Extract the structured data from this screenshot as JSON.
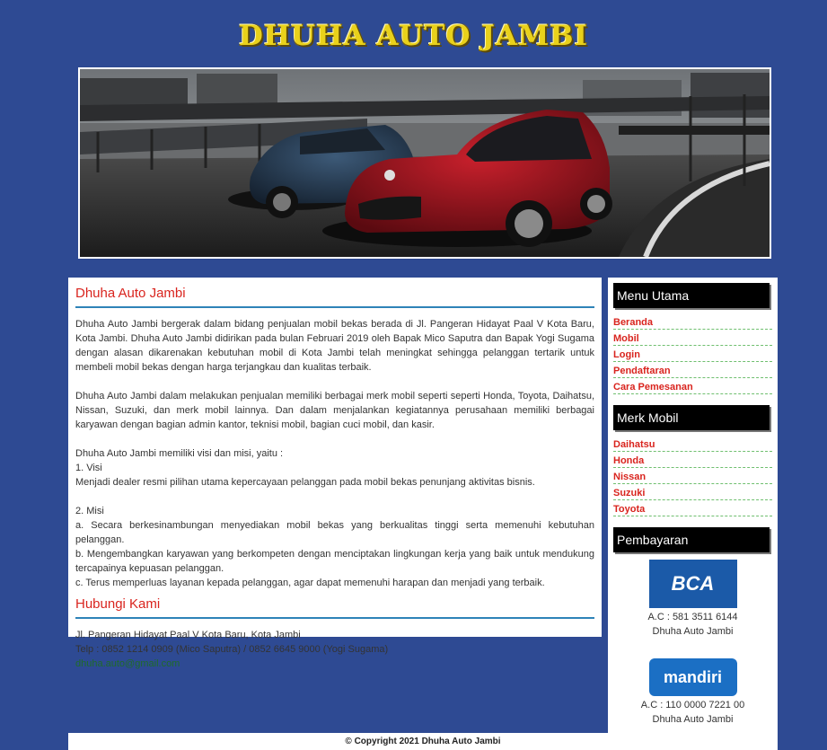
{
  "header": {
    "site_title": "DHUHA AUTO JAMBI"
  },
  "main": {
    "about_title": "Dhuha Auto Jambi",
    "paragraphs": [
      "Dhuha Auto Jambi bergerak dalam bidang penjualan mobil bekas berada di Jl. Pangeran Hidayat Paal V Kota Baru, Kota Jambi. Dhuha Auto Jambi didirikan pada bulan Februari 2019 oleh Bapak Mico Saputra dan Bapak Yogi Sugama dengan alasan dikarenakan kebutuhan mobil di Kota Jambi telah meningkat sehingga pelanggan tertarik untuk membeli mobil bekas dengan harga terjangkau dan kualitas terbaik.",
      "Dhuha Auto Jambi dalam melakukan penjualan memiliki berbagai merk mobil seperti seperti Honda, Toyota, Daihatsu, Nissan, Suzuki, dan merk mobil lainnya. Dan dalam menjalankan kegiatannya perusahaan memiliki berbagai karyawan dengan bagian admin kantor, teknisi mobil, bagian cuci mobil, dan kasir."
    ],
    "visi_misi_intro": "Dhuha Auto Jambi memiliki visi dan misi, yaitu :",
    "visi_label": "1. Visi",
    "visi_text": "Menjadi dealer resmi pilihan utama kepercayaan pelanggan pada mobil bekas penunjang aktivitas bisnis.",
    "misi_label": "2. Misi",
    "misi_items": [
      "a. Secara berkesinambungan menyediakan mobil bekas yang berkualitas tinggi serta memenuhi kebutuhan pelanggan.",
      "b. Mengembangkan karyawan yang berkompeten dengan menciptakan lingkungan kerja yang baik untuk mendukung tercapainya kepuasan pelanggan.",
      "c. Terus memperluas layanan kepada pelanggan, agar dapat memenuhi harapan dan menjadi yang terbaik."
    ],
    "contact_title": "Hubungi Kami",
    "contact_address": "Jl. Pangeran Hidayat Paal V Kota Baru, Kota Jambi",
    "contact_phone": "Telp : 0852 1214 0909 (Mico Saputra) / 0852 6645 9000 (Yogi Sugama)",
    "contact_email": "dhuha.auto@gmail.com"
  },
  "sidebar": {
    "menu_title": "Menu Utama",
    "menu_items": [
      "Beranda",
      "Mobil",
      "Login",
      "Pendaftaran",
      "Cara Pemesanan"
    ],
    "brand_title": "Merk Mobil",
    "brand_items": [
      "Daihatsu",
      "Honda",
      "Nissan",
      "Suzuki",
      "Toyota"
    ],
    "payment_title": "Pembayaran",
    "bca_logo_text": "BCA",
    "bca_account": "A.C : 581 3511 6144",
    "bca_name": "Dhuha Auto Jambi",
    "mandiri_logo_text": "mandiri",
    "mandiri_account": "A.C : 110 0000 7221 00",
    "mandiri_name": "Dhuha Auto Jambi"
  },
  "footer": {
    "copyright": "© Copyright 2021 Dhuha Auto Jambi"
  }
}
